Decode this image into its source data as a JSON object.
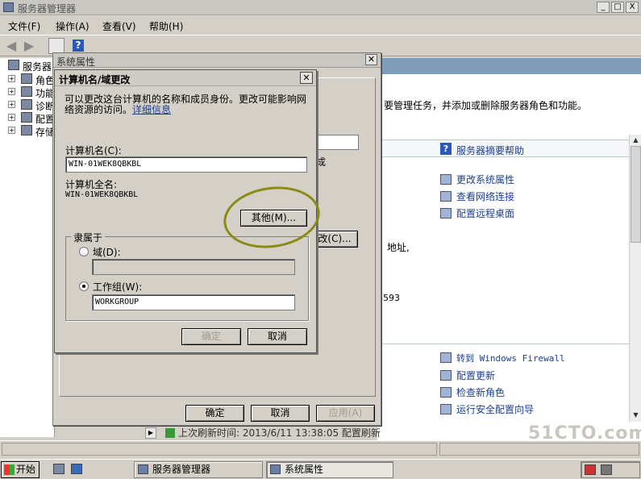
{
  "main_window": {
    "title": "服务器管理器",
    "menu": [
      "文件(F)",
      "操作(A)",
      "查看(V)",
      "帮助(H)"
    ],
    "window_buttons": [
      "_",
      "□",
      "X"
    ]
  },
  "tree": {
    "root": "服务器",
    "items": [
      "角色",
      "功能",
      "诊断",
      "配置",
      "存储"
    ]
  },
  "content": {
    "top_text": "要管理任务，并添加或删除服务器角色和功能。",
    "help_link": "服务器摘要帮助",
    "links_top": [
      "更改系统属性",
      "查看网络连接",
      "配置远程桌面"
    ],
    "address_text": "地址,",
    "number_fragment": "6593",
    "links_bottom": [
      "转到 Windows Firewall",
      "配置更新",
      "检查新角色",
      "运行安全配置向导"
    ],
    "last_refresh": "上次刷新时间: 2013/6/11 13:38:05  配置刷新"
  },
  "sysprop": {
    "title": "系统属性",
    "fragment_cheng": "成",
    "change_button_fragment": "改(C)...",
    "ok": "确定",
    "cancel": "取消",
    "apply": "应用(A)"
  },
  "dialog": {
    "title": "计算机名/域更改",
    "description": "可以更改这台计算机的名称和成员身份。更改可能影响网络资源的访问。",
    "more_info_link": "详细信息",
    "computer_name_label": "计算机名(C):",
    "computer_name_value": "WIN-01WEK8QBKBL",
    "full_name_label": "计算机全名:",
    "full_name_value": "WIN-01WEK8QBKBL",
    "other_button": "其他(M)...",
    "member_of_label": "隶属于",
    "domain_label": "域(D):",
    "domain_value": "",
    "workgroup_label": "工作组(W):",
    "workgroup_value": "WORKGROUP",
    "selected": "workgroup",
    "ok": "确定",
    "cancel": "取消"
  },
  "taskbar": {
    "start": "开始",
    "tasks": [
      "服务器管理器",
      "系统属性"
    ],
    "active_task": "系统属性"
  },
  "watermark": "51CTO.com",
  "annotation_color": "#8a8a14"
}
